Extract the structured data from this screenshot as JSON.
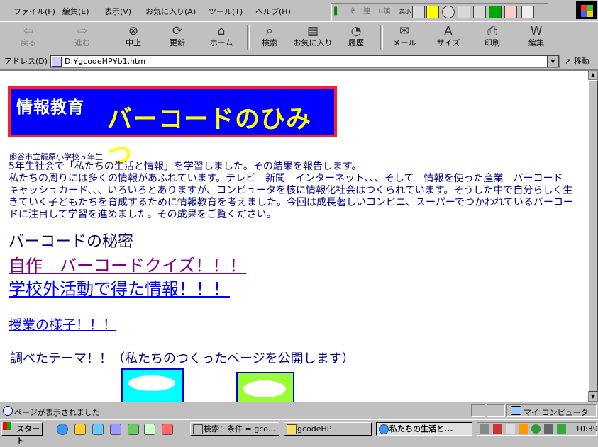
{
  "menu": {
    "items": [
      "ファイル(F)",
      "編集(E)",
      "表示(V)",
      "お気に入り(A)",
      "ツール(T)",
      "ヘルプ(H)"
    ]
  },
  "ime": {
    "glyphs": [
      "あ",
      "連",
      "R漢",
      "英小"
    ]
  },
  "toolbar": {
    "back": "戻る",
    "forward": "進む",
    "stop": "中止",
    "refresh": "更新",
    "home": "ホーム",
    "search": "検索",
    "favorites": "お気に入り",
    "history": "履歴",
    "mail": "メール",
    "size": "サイズ",
    "print": "印刷",
    "edit": "編集"
  },
  "address": {
    "label": "アドレス(D)",
    "url": "D:¥gcodeHP¥b1.htm",
    "go": "移動"
  },
  "page": {
    "banner_small": "情報教育",
    "banner_big": "バーコードのひみつ",
    "school": "熊谷市立籠原小学校５年生",
    "para1": "5年生社会で「私たちの生活と情報」を学習しました。その結果を報告します。",
    "para2": "私たちの周りには多くの情報があふれています。テレビ　新聞　インターネット、、、そして　情報を使った産業　バーコード　キャッシュカード、、、いろいろとありますが、コンピュータを核に情報化社会はつくられています。そうした中で自分らしく生きていく子どもたちを育成するために情報教育を考えました。今回は成長著しいコンビニ、スーパーでつかわれているバーコードに注目して学習を進めました。その成果をご覧ください。",
    "heading_secret": "バーコードの秘密",
    "link_quiz": "自作　バーコードクイズ！！！",
    "link_outside": "学校外活動で得た情報！！！",
    "link_class": "授業の様子！！！",
    "themes": "調べたテーマ！！（私たちのつくったページを公開します）"
  },
  "status": {
    "text": "ページが表示されました",
    "zone": "マイ コンピュータ"
  },
  "taskbar": {
    "start": "スタート",
    "tasks": [
      "検索：条件 = gco...",
      "gcodeHP",
      "私たちの生活と..."
    ],
    "clock": "10:39"
  },
  "colors": {
    "banner_bg": "#0000ff",
    "banner_border": "#ff2020",
    "banner_big": "#ffff00",
    "link": "#0000ff",
    "visited": "#800080"
  }
}
